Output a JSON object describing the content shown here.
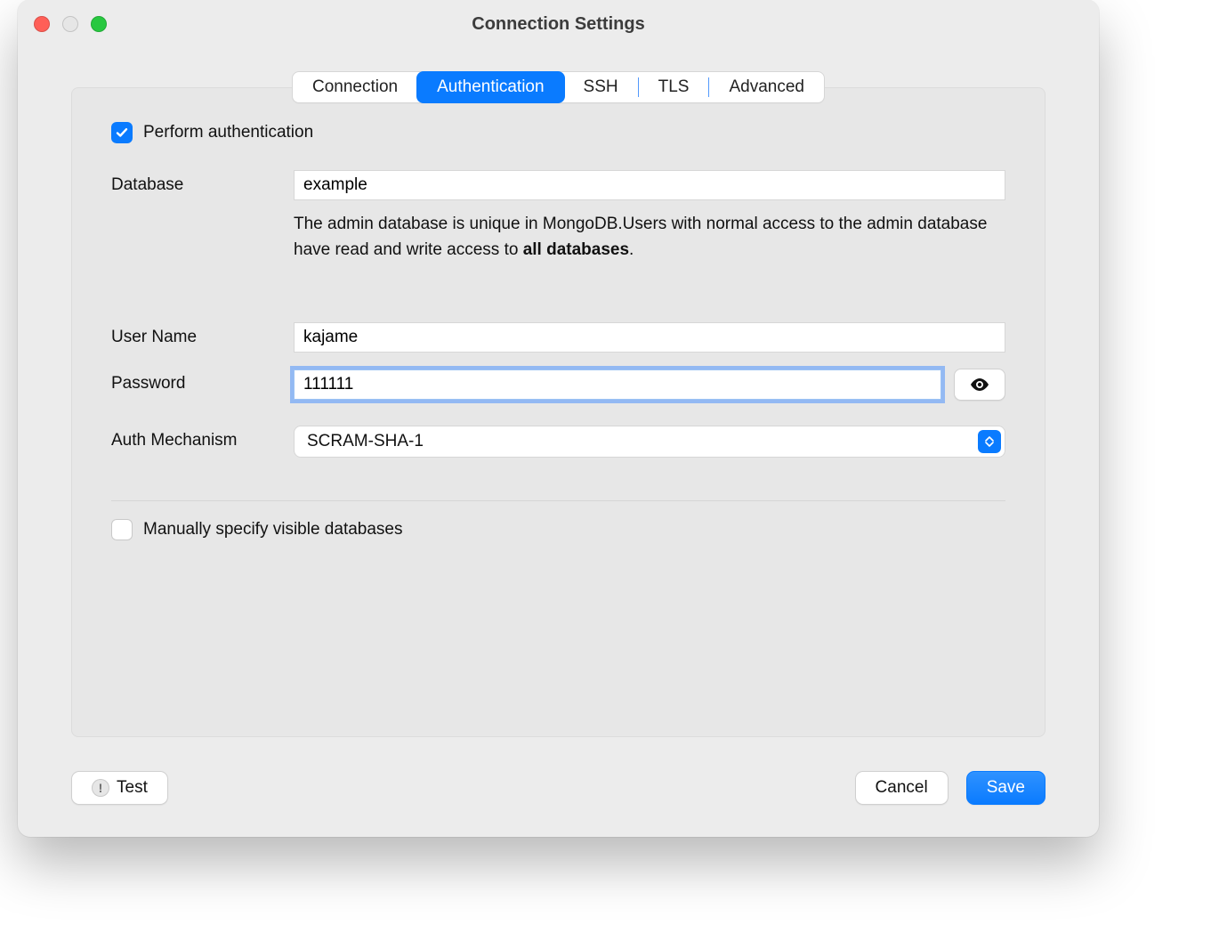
{
  "window": {
    "title": "Connection Settings"
  },
  "tabs": {
    "connection": "Connection",
    "authentication": "Authentication",
    "ssh": "SSH",
    "tls": "TLS",
    "advanced": "Advanced"
  },
  "auth": {
    "perform_label": "Perform authentication",
    "perform_checked": true,
    "database_label": "Database",
    "database_value": "example",
    "database_hint_1": "The admin database is unique in MongoDB.Users with normal access to the admin database have read and write access to ",
    "database_hint_bold": "all databases",
    "database_hint_2": ".",
    "username_label": "User Name",
    "username_value": "kajame",
    "password_label": "Password",
    "password_value": "111111",
    "mechanism_label": "Auth Mechanism",
    "mechanism_value": "SCRAM-SHA-1",
    "manual_db_label": "Manually specify visible databases",
    "manual_db_checked": false
  },
  "footer": {
    "test": "Test",
    "cancel": "Cancel",
    "save": "Save"
  }
}
